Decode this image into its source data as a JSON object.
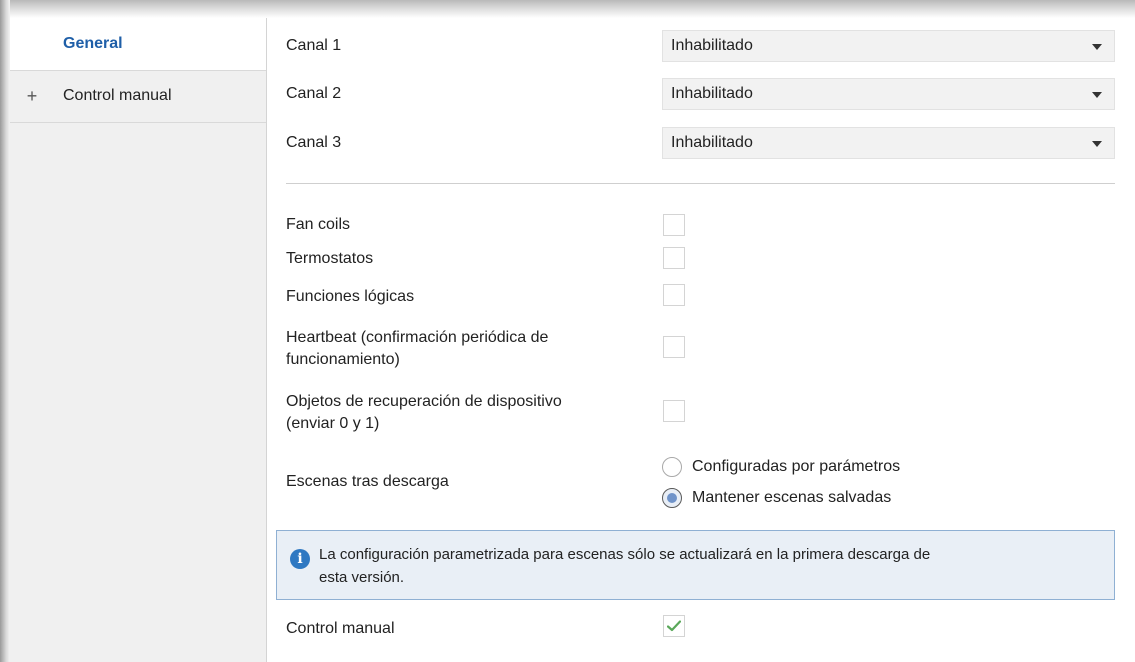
{
  "sidebar": {
    "items": [
      {
        "label": "General",
        "active": true,
        "expandable": false
      },
      {
        "label": "Control manual",
        "active": false,
        "expandable": true,
        "expand_symbol": "+"
      }
    ]
  },
  "channels": [
    {
      "label": "Canal 1",
      "value": "Inhabilitado"
    },
    {
      "label": "Canal 2",
      "value": "Inhabilitado"
    },
    {
      "label": "Canal 3",
      "value": "Inhabilitado"
    }
  ],
  "options": [
    {
      "label": "Fan coils",
      "checked": false
    },
    {
      "label": "Termostatos",
      "checked": false
    },
    {
      "label": "Funciones lógicas",
      "checked": false
    },
    {
      "label_line1": "Heartbeat (confirmación periódica de",
      "label_line2": "funcionamiento)",
      "checked": false
    },
    {
      "label_line1": "Objetos de recuperación de dispositivo",
      "label_line2": "(enviar 0 y 1)",
      "checked": false
    }
  ],
  "scenes": {
    "label": "Escenas tras descarga",
    "choices": [
      {
        "label": "Configuradas por parámetros",
        "selected": false
      },
      {
        "label": "Mantener escenas salvadas",
        "selected": true
      }
    ]
  },
  "info": {
    "icon": "info-icon",
    "line1": "La configuración parametrizada para escenas sólo se actualizará en la primera descarga de",
    "line2": "esta versión."
  },
  "manual_control": {
    "label": "Control manual",
    "checked": true
  },
  "colors": {
    "accent": "#1f5fa8",
    "sidebar_bg": "#f0f0f0",
    "info_bg": "#e9eff6",
    "info_border": "#8fb0d3",
    "check_green": "#5aa85a"
  }
}
